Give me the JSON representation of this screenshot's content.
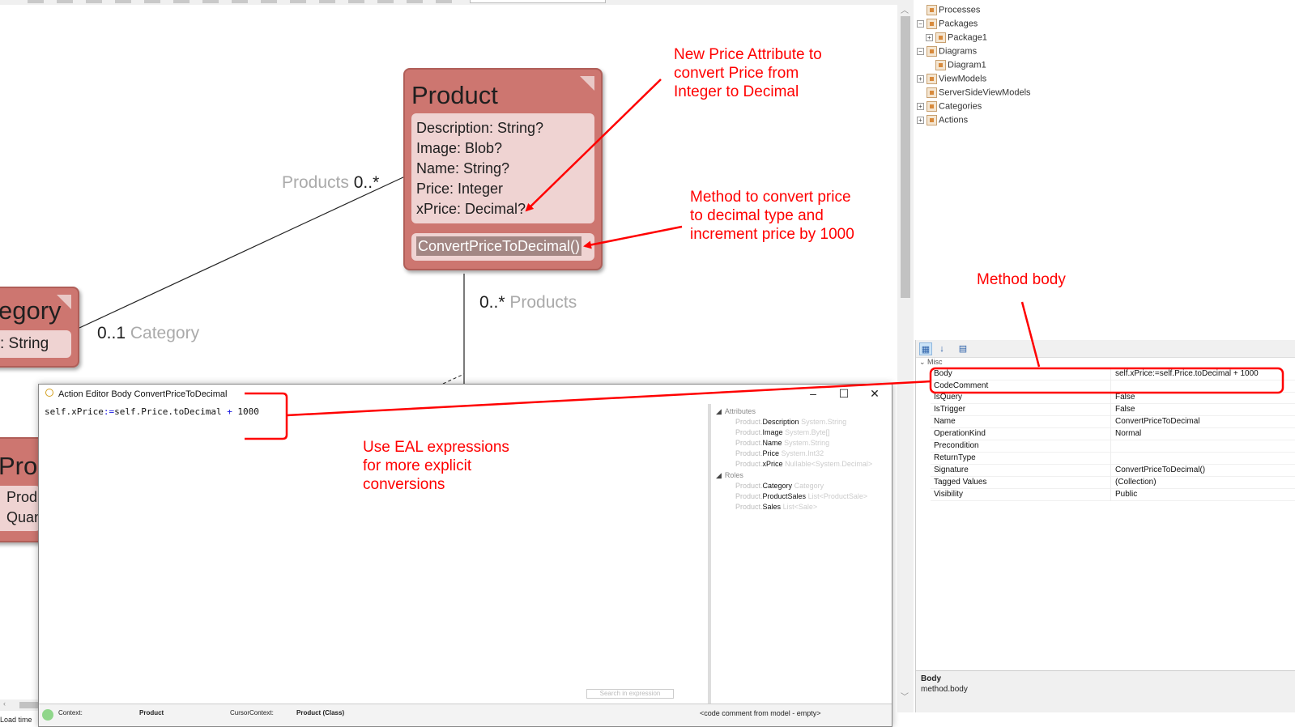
{
  "diagram": {
    "product_class": {
      "title": "Product",
      "attributes": [
        "Description: String?",
        "Image: Blob?",
        "Name: String?",
        "Price: Integer",
        "xPrice: Decimal?"
      ],
      "operation": "ConvertPriceToDecimal()"
    },
    "category_class": {
      "title_fragment": "egory",
      "attribute_fragment": ": String"
    },
    "productsale_class": {
      "title_fragment": "Pro",
      "attr1_fragment": "Prod",
      "attr2_fragment": "Quan"
    },
    "assoc_products_top": {
      "role": "Products",
      "mult": "0..*"
    },
    "assoc_category": {
      "mult": "0..1",
      "role": "Category"
    },
    "assoc_products_bottom": {
      "mult": "0..*",
      "role": "Products"
    }
  },
  "annotations": {
    "new_price_attr": "New Price Attribute to\nconvert Price from\nInteger to Decimal",
    "method_convert": "Method to convert price\nto decimal type and\nincrement price by 1000",
    "method_body": "Method body",
    "use_eal": "Use EAL expressions\nfor more explicit\nconversions"
  },
  "tree": {
    "items": [
      {
        "label": "Processes",
        "expander": ""
      },
      {
        "label": "Packages",
        "expander": "−"
      },
      {
        "label": "Package1",
        "expander": "+"
      },
      {
        "label": "Diagrams",
        "expander": "−"
      },
      {
        "label": "Diagram1",
        "expander": ""
      },
      {
        "label": "ViewModels",
        "expander": "+"
      },
      {
        "label": "ServerSideViewModels",
        "expander": ""
      },
      {
        "label": "Categories",
        "expander": "+"
      },
      {
        "label": "Actions",
        "expander": "+"
      }
    ]
  },
  "property_grid": {
    "group": "Misc",
    "rows": [
      {
        "key": "Body",
        "value": "self.xPrice:=self.Price.toDecimal + 1000"
      },
      {
        "key": "CodeComment",
        "value": ""
      },
      {
        "key": "IsQuery",
        "value": "False"
      },
      {
        "key": "IsTrigger",
        "value": "False"
      },
      {
        "key": "Name",
        "value": "ConvertPriceToDecimal"
      },
      {
        "key": "OperationKind",
        "value": "Normal"
      },
      {
        "key": "Precondition",
        "value": ""
      },
      {
        "key": "ReturnType",
        "value": ""
      },
      {
        "key": "Signature",
        "value": "ConvertPriceToDecimal()"
      },
      {
        "key": "Tagged Values",
        "value": "(Collection)"
      },
      {
        "key": "Visibility",
        "value": "Public"
      }
    ],
    "desc_title": "Body",
    "desc_text": "method.body"
  },
  "action_editor": {
    "title": "Action Editor Body ConvertPriceToDecimal",
    "code_lhs": "self.xPrice",
    "code_assign": ":=",
    "code_mid": "self.Price.toDecimal ",
    "code_plus": "+",
    "code_num": " 1000",
    "side_panel": {
      "attributes_header": "Attributes",
      "attributes": [
        {
          "owner": "Product.",
          "name": "Description",
          "type": "System.String"
        },
        {
          "owner": "Product.",
          "name": "Image",
          "type": "System.Byte[]"
        },
        {
          "owner": "Product.",
          "name": "Name",
          "type": "System.String"
        },
        {
          "owner": "Product.",
          "name": "Price",
          "type": "System.Int32"
        },
        {
          "owner": "Product.",
          "name": "xPrice",
          "type": "Nullable<System.Decimal>"
        }
      ],
      "roles_header": "Roles",
      "roles": [
        {
          "owner": "Product.",
          "name": "Category",
          "type": "Category"
        },
        {
          "owner": "Product.",
          "name": "ProductSales",
          "type": "List<ProductSale>"
        },
        {
          "owner": "Product.",
          "name": "Sales",
          "type": "List<Sale>"
        }
      ]
    },
    "search_placeholder": "Search in expression",
    "status": {
      "context_label": "Context:",
      "context_value": "Product",
      "cursor_label": "CursorContext:",
      "cursor_value": "Product (Class)",
      "code_comment": "<code comment from model - empty>"
    }
  },
  "footer": {
    "load_time": "Load time"
  },
  "colors": {
    "annotation": "#ff0000",
    "class_fill": "#cd7670",
    "compartment": "#efd3d2"
  }
}
